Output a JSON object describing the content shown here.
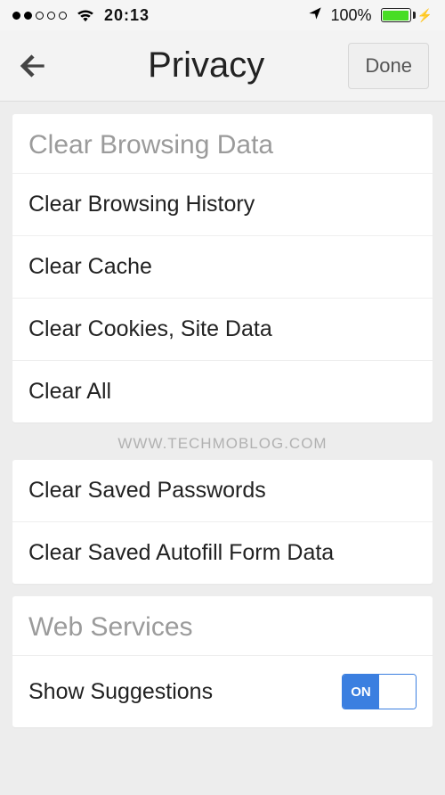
{
  "status": {
    "time": "20:13",
    "battery_pct": "100%"
  },
  "nav": {
    "title": "Privacy",
    "done": "Done"
  },
  "sections": {
    "clear_data": {
      "header": "Clear Browsing Data",
      "items": [
        "Clear Browsing History",
        "Clear Cache",
        "Clear Cookies, Site Data",
        "Clear All"
      ]
    },
    "saved": {
      "items": [
        "Clear Saved Passwords",
        "Clear Saved Autofill Form Data"
      ]
    },
    "web_services": {
      "header": "Web Services",
      "items": [
        {
          "label": "Show Suggestions",
          "toggle": "ON"
        }
      ]
    }
  },
  "watermark": "WWW.TECHMOBLOG.COM"
}
